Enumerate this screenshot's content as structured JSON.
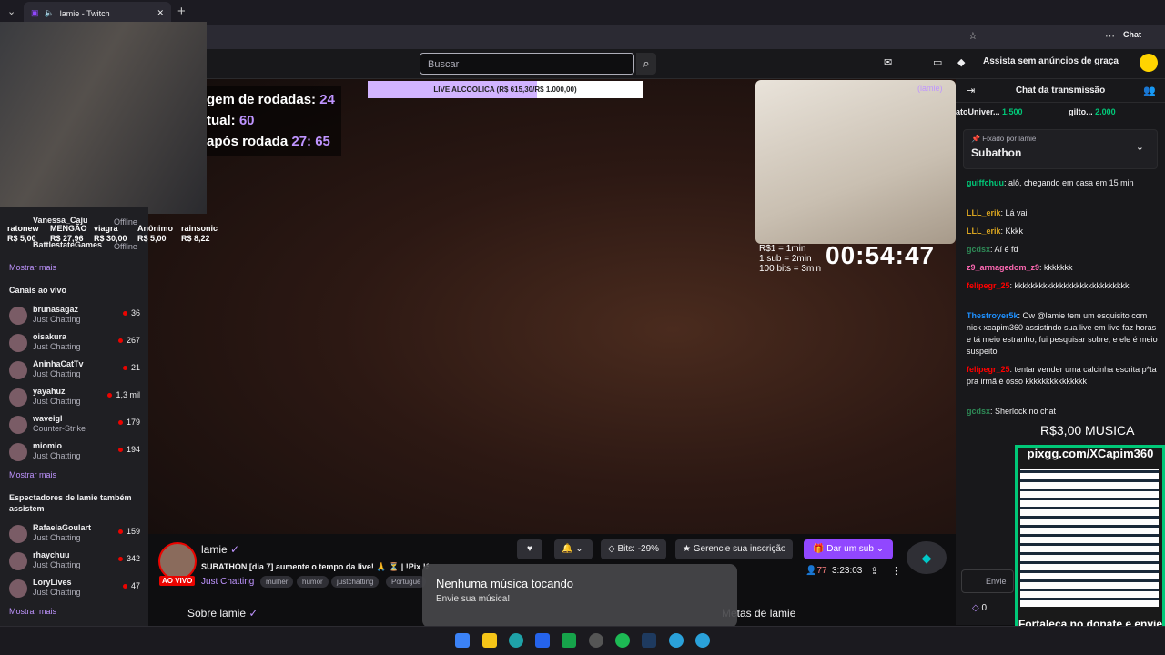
{
  "browser": {
    "tab_title": "lamie - Twitch",
    "chat_button": "Chat"
  },
  "header": {
    "search_placeholder": "Buscar",
    "no_ads": "Assista sem anúncios de graça"
  },
  "webcam_overlay": {
    "offline1": "Offline",
    "offline2": "Offline",
    "name1": "Vanessa_Caju",
    "name2": "BattlestateGames"
  },
  "donors": {
    "names": [
      "ratonew",
      "MENGÃO",
      "viagra",
      "Anônimo",
      "rainsonic"
    ],
    "amounts": [
      "R$ 5,00",
      "R$ 27,96",
      "R$ 30,00",
      "R$ 5,00",
      "R$ 8,22"
    ]
  },
  "overlay": {
    "line1": "gem de rodadas:",
    "v1": "24",
    "line2": "tual:",
    "v2": "60",
    "line3": "após rodada",
    "v3a": "27:",
    "v3b": "65"
  },
  "goal": {
    "label": "LIVE ALCOOLICA (R$ 615,30/R$ 1.000,00)",
    "progress": 0.6153,
    "corner": "(lamie)"
  },
  "rates": {
    "r1": "R$1 = 1min",
    "r2": "1 sub = 2min",
    "r3": "100 bits = 3min"
  },
  "timer": "00:54:47",
  "sidebar": {
    "more1": "Mostrar mais",
    "live_title": "Canais ao vivo",
    "channels": [
      {
        "name": "brunasagaz",
        "game": "Just Chatting",
        "viewers": "36"
      },
      {
        "name": "oisakura",
        "game": "Just Chatting",
        "viewers": "267"
      },
      {
        "name": "AninhaCatTv",
        "game": "Just Chatting",
        "viewers": "21"
      },
      {
        "name": "yayahuz",
        "game": "Just Chatting",
        "viewers": "1,3 mil"
      },
      {
        "name": "waveigl",
        "game": "Counter-Strike",
        "viewers": "179"
      },
      {
        "name": "miomio",
        "game": "Just Chatting",
        "viewers": "194"
      }
    ],
    "more2": "Mostrar mais",
    "also_title": "Espectadores de lamie também assistem",
    "also": [
      {
        "name": "RafaelaGoulart",
        "game": "Just Chatting",
        "viewers": "159"
      },
      {
        "name": "rhaychuu",
        "game": "Just Chatting",
        "viewers": "342"
      },
      {
        "name": "LoryLives",
        "game": "Just Chatting",
        "viewers": "47"
      }
    ],
    "more3": "Mostrar mais"
  },
  "stream": {
    "name": "lamie",
    "live": "AO VIVO",
    "title": "SUBATHON [dia 7] aumente o tempo da live! 🙏 ⏳ | !Pix !SongPix - para colocar musica",
    "category": "Just Chatting",
    "tags": [
      "mulher",
      "humor",
      "justchatting",
      "Portuguê"
    ],
    "bits": "Bits: -29%",
    "manage_sub": "Gerencie sua inscrição",
    "sub": "Dar um sub",
    "viewers": "77",
    "uptime": "3:23:03",
    "about": "Sobre lamie",
    "metas": "Metas de lamie"
  },
  "music": {
    "title": "Nenhuma música tocando",
    "subtitle": "Envie sua música!"
  },
  "chat": {
    "title": "Chat da transmissão",
    "top1": "atoUniver...",
    "top1v": "1.500",
    "top2": "gilto...",
    "top2v": "2.000",
    "pinned_by": "Fixado por",
    "pinned_user": "lamie",
    "pinned_text": "Subathon",
    "messages": [
      {
        "user": "guiffchuu",
        "color": "#00c878",
        "text": ": alô, chegando em casa em 15 min"
      },
      {
        "user": "LLL_erik",
        "color": "#daa520",
        "text": ": Lá vai"
      },
      {
        "user": "LLL_erik",
        "color": "#daa520",
        "text": ": Kkkk"
      },
      {
        "user": "gcdsx",
        "color": "#2e8b57",
        "text": ": Aí é fd"
      },
      {
        "user": "z9_armagedom_z9",
        "color": "#ff69b4",
        "text": ": kkkkkkk"
      },
      {
        "user": "felipegr_25",
        "color": "#ff0000",
        "text": ": kkkkkkkkkkkkkkkkkkkkkkkkkkkk"
      },
      {
        "user": "Thestroyer5k",
        "color": "#1e90ff",
        "text": ": Ow @lamie tem um esquisito com nick xcapim360 assistindo sua live em live faz horas e tá meio estranho, fui pesquisar sobre, e ele é meio suspeito"
      },
      {
        "user": "felipegr_25",
        "color": "#ff0000",
        "text": ": tentar vender uma calcinha escrita p*ta pra irmã é osso kkkkkkkkkkkkkkk"
      },
      {
        "user": "gcdsx",
        "color": "#2e8b57",
        "text": ": Sherlock no chat"
      }
    ],
    "input_placeholder": "Envie",
    "points": "0"
  },
  "qr": {
    "musica": "R$3,00 MUSICA",
    "url": "pixgg.com/XCapim360",
    "footer": "Fortaleça no donate e envie sua mensagem!"
  }
}
